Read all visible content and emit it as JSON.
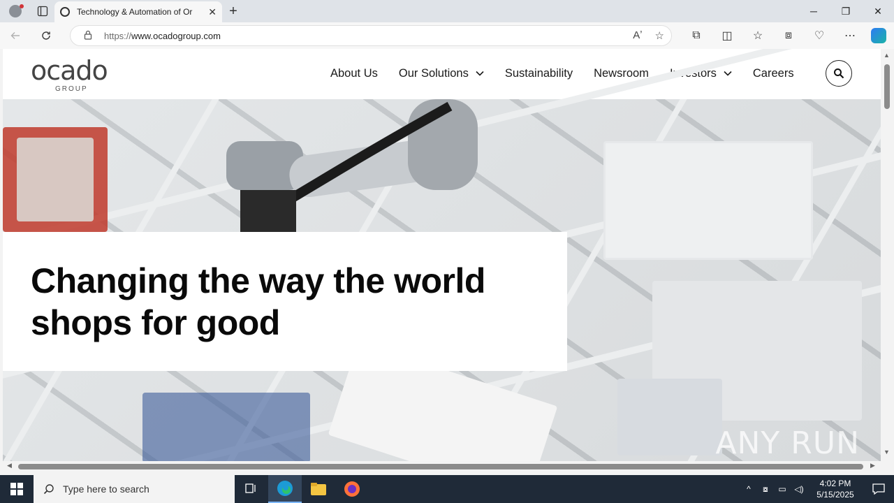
{
  "browser": {
    "tab_title": "Technology & Automation of Or",
    "url_scheme": "https://",
    "url_host": "www.ocadogroup.com",
    "tab_close": "✕",
    "new_tab": "+",
    "window_min": "─",
    "window_restore": "❐",
    "window_close": "✕"
  },
  "site": {
    "logo_word": "ocado",
    "logo_sub": "GROUP",
    "nav": [
      {
        "label": "About Us",
        "has_dropdown": false
      },
      {
        "label": "Our Solutions",
        "has_dropdown": true
      },
      {
        "label": "Sustainability",
        "has_dropdown": false
      },
      {
        "label": "Newsroom",
        "has_dropdown": false
      },
      {
        "label": "Investors",
        "has_dropdown": true
      },
      {
        "label": "Careers",
        "has_dropdown": false
      }
    ],
    "hero_headline": "Changing the way the world shops for good"
  },
  "watermark": "ANY RUN",
  "taskbar": {
    "search_placeholder": "Type here to search",
    "time": "4:02 PM",
    "date": "5/15/2025"
  },
  "colors": {
    "taskbar_bg": "#1f2a38",
    "accent": "#0078d4"
  }
}
